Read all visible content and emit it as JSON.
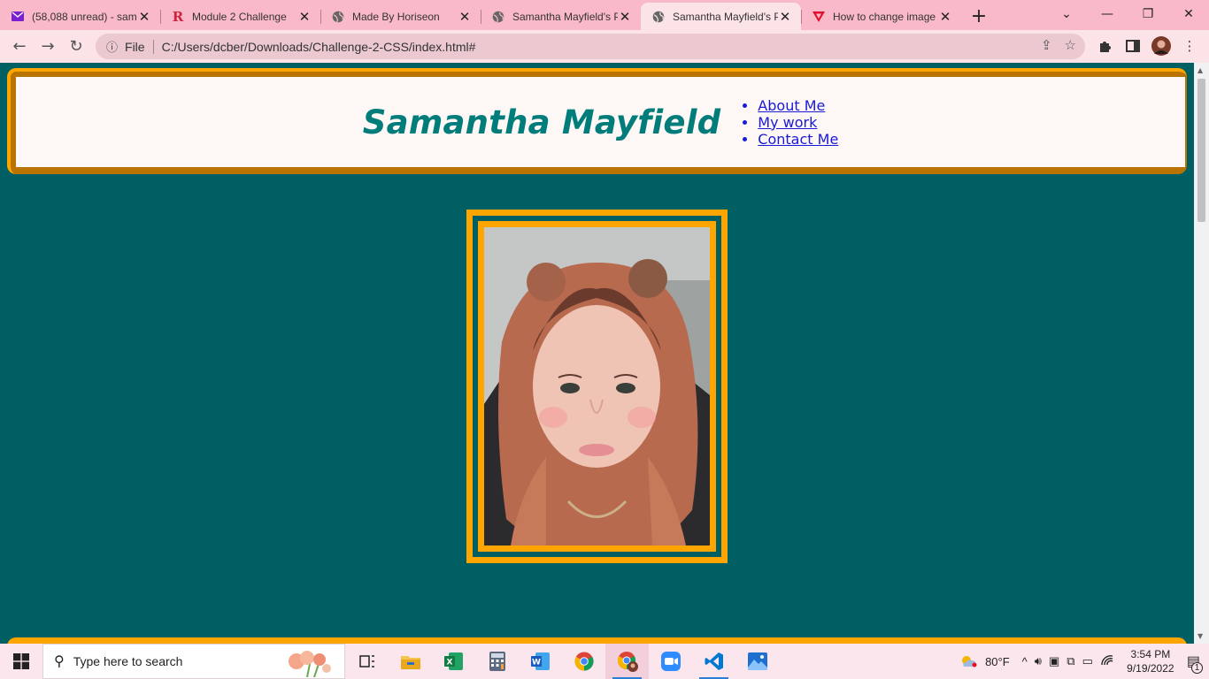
{
  "browser": {
    "tabs": [
      {
        "label": "(58,088 unread) - sam",
        "icon": "mail-icon",
        "active": false
      },
      {
        "label": "Module 2 Challenge",
        "icon": "r-logo-icon",
        "active": false
      },
      {
        "label": "Made By Horiseon",
        "icon": "globe-icon",
        "active": false
      },
      {
        "label": "Samantha Mayfield's P",
        "icon": "globe-icon",
        "active": false
      },
      {
        "label": "Samantha Mayfield's P",
        "icon": "globe-icon",
        "active": true
      },
      {
        "label": "How to change image",
        "icon": "triangle-logo-icon",
        "active": false
      }
    ],
    "address": {
      "scheme_label": "File",
      "url": "C:/Users/dcber/Downloads/Challenge-2-CSS/index.html#"
    }
  },
  "page": {
    "site_title": "Samantha Mayfield",
    "nav": [
      "About Me",
      "My work",
      "Contact Me"
    ],
    "colors": {
      "background": "#005f62",
      "accent": "#ffa500",
      "header_shadow": "#b97400",
      "title": "#007d7a",
      "link": "#1a1ad6"
    }
  },
  "taskbar": {
    "search_placeholder": "Type here to search",
    "weather": "80°F",
    "time": "3:54 PM",
    "date": "9/19/2022",
    "notification_count": "1",
    "apps": [
      "task-view-icon",
      "file-explorer-icon",
      "excel-icon",
      "calculator-icon",
      "word-icon",
      "chrome-icon",
      "chrome-profile-icon",
      "zoom-icon",
      "vscode-icon",
      "photos-icon"
    ]
  }
}
